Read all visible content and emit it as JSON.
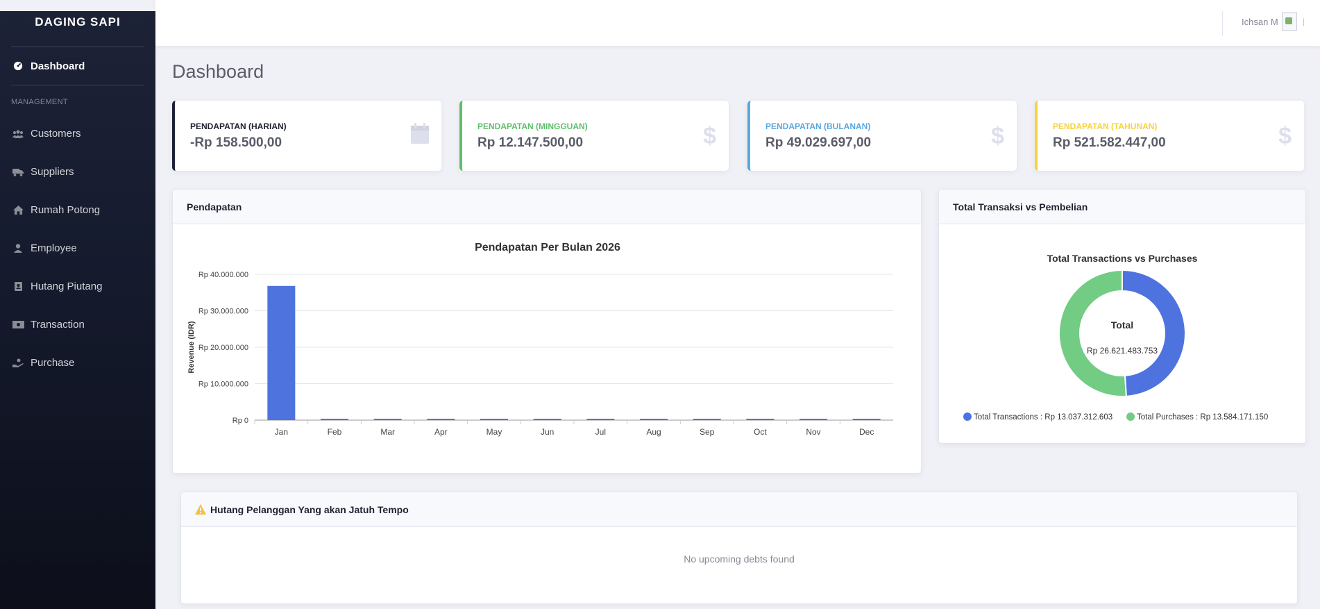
{
  "sidebar": {
    "brand": "DAGING SAPI",
    "dashboard": {
      "label": "Dashboard",
      "icon": "gauge-icon"
    },
    "heading": "MANAGEMENT",
    "items": [
      {
        "label": "Customers",
        "icon": "users-icon"
      },
      {
        "label": "Suppliers",
        "icon": "truck-icon"
      },
      {
        "label": "Rumah Potong",
        "icon": "home-icon"
      },
      {
        "label": "Employee",
        "icon": "user-icon"
      },
      {
        "label": "Hutang Piutang",
        "icon": "address-book-icon"
      },
      {
        "label": "Transaction",
        "icon": "money-bill-icon"
      },
      {
        "label": "Purchase",
        "icon": "hand-holding-icon"
      }
    ]
  },
  "topbar": {
    "user_name": "Ichsan M",
    "trailing": "|"
  },
  "page": {
    "title": "Dashboard"
  },
  "stats": [
    {
      "label": "PENDAPATAN (HARIAN)",
      "value": "-Rp 158.500,00",
      "color": "#1d2237",
      "label_color": "#1f2230",
      "icon": "calendar-icon"
    },
    {
      "label": "PENDAPATAN (MINGGUAN)",
      "value": "Rp 12.147.500,00",
      "color": "#5fbf6b",
      "label_color": "#5fbf6b",
      "icon": "dollar-icon"
    },
    {
      "label": "PENDAPATAN (BULANAN)",
      "value": "Rp 49.029.697,00",
      "color": "#5aa7e0",
      "label_color": "#5aa7e0",
      "icon": "dollar-icon"
    },
    {
      "label": "PENDAPATAN (TAHUNAN)",
      "value": "Rp 521.582.447,00",
      "color": "#f6d33c",
      "label_color": "#f6d33c",
      "icon": "dollar-icon"
    }
  ],
  "revenue_card": {
    "header": "Pendapatan"
  },
  "pie_card": {
    "header": "Total Transaksi vs Pembelian"
  },
  "debt_card": {
    "header": "Hutang Pelanggan Yang akan Jatuh Tempo",
    "empty": "No upcoming debts found"
  },
  "chart_data": [
    {
      "type": "bar",
      "title": "Pendapatan Per Bulan 2026",
      "xlabel": "",
      "ylabel": "Revenue (IDR)",
      "categories": [
        "Jan",
        "Feb",
        "Mar",
        "Apr",
        "May",
        "Jun",
        "Jul",
        "Aug",
        "Sep",
        "Oct",
        "Nov",
        "Dec"
      ],
      "values": [
        36800000,
        158500,
        0,
        0,
        0,
        0,
        0,
        0,
        0,
        0,
        0,
        0
      ],
      "ylim": [
        0,
        40000000
      ],
      "yticks": [
        "Rp 0",
        "Rp 10.000.000",
        "Rp 20.000.000",
        "Rp 30.000.000",
        "Rp 40.000.000"
      ],
      "grid": true,
      "color": "#4e73df"
    },
    {
      "type": "pie",
      "title": "Total Transactions vs Purchases",
      "center_label": "Total",
      "center_value": "Rp 26.621.483.753",
      "slices": [
        {
          "name": "Total Transactions",
          "value": 13037312603,
          "legend": "Total Transactions : Rp 13.037.312.603",
          "color": "#4e73df"
        },
        {
          "name": "Total Purchases",
          "value": 13584171150,
          "legend": "Total Purchases : Rp 13.584.171.150",
          "color": "#72cc84"
        }
      ],
      "legend_position": "bottom"
    }
  ]
}
